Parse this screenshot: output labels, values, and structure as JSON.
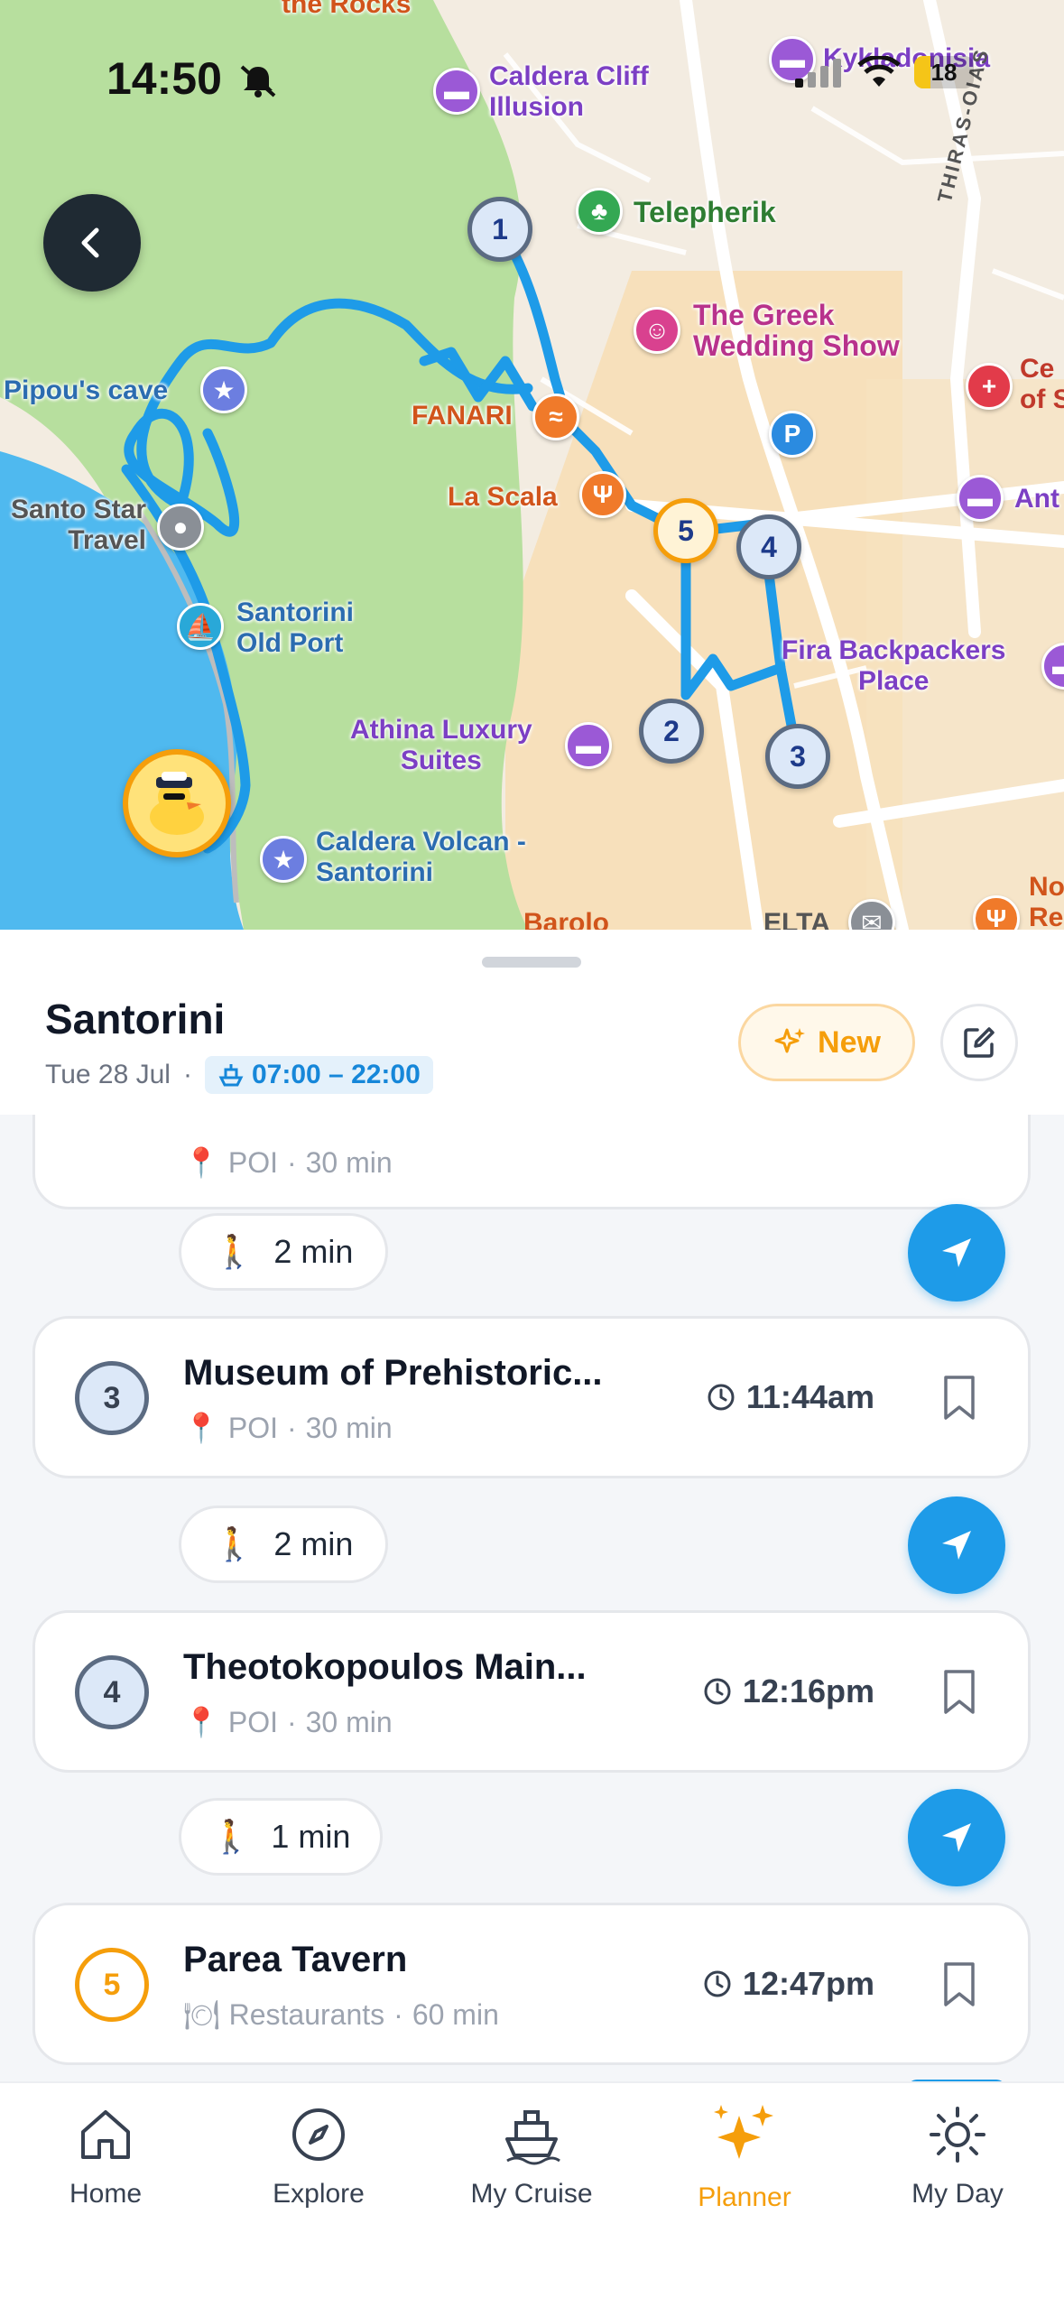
{
  "status_bar": {
    "time": "14:50",
    "battery": "18"
  },
  "map": {
    "labels": {
      "the_rocks": "the Rocks",
      "caldera_cliff": "Caldera Cliff\nIllusion",
      "kykladonisia": "Kykladonisia",
      "telepherik": "Telepherik",
      "thiras_oias": "THIRAS-OIAS",
      "greek_wedding": "The Greek\nWedding Show",
      "pipous_cave": "Pipou's cave",
      "fanari": "FANARI",
      "la_scala": "La Scala",
      "santo_star": "Santo Star\nTravel",
      "old_port": "Santorini\nOld Port",
      "fira_backpackers": "Fira Backpackers\nPlace",
      "athina": "Athina Luxury\nSuites",
      "caldera_volcan": "Caldera Volcan -\nSantorini",
      "barolo": "Barolo",
      "elta": "ELTA",
      "ce_of_s": "Ce\nof S",
      "ant": "Ant",
      "no_re": "No\nRe"
    },
    "stops": [
      "1",
      "2",
      "3",
      "4",
      "5"
    ]
  },
  "header": {
    "title": "Santorini",
    "date": "Tue 28 Jul",
    "separator": "·",
    "hours": "07:00 – 22:00",
    "new_label": "New"
  },
  "itinerary": {
    "partial_card": {
      "category": "POI",
      "duration": "30 min",
      "dot": "·"
    },
    "walks": [
      "2 min",
      "2 min",
      "1 min"
    ],
    "items": [
      {
        "number": "3",
        "name": "Museum of Prehistoric...",
        "category": "POI",
        "duration": "30 min",
        "dot": "·",
        "time": "11:44am"
      },
      {
        "number": "4",
        "name": "Theotokopoulos Main...",
        "category": "POI",
        "duration": "30 min",
        "dot": "·",
        "time": "12:16pm"
      },
      {
        "number": "5",
        "name": "Parea Tavern",
        "category": "Restaurants",
        "duration": "60 min",
        "dot": "·",
        "time": "12:47pm"
      }
    ]
  },
  "tabs": [
    {
      "label": "Home",
      "icon": "house-icon"
    },
    {
      "label": "Explore",
      "icon": "compass-icon"
    },
    {
      "label": "My Cruise",
      "icon": "ship-icon"
    },
    {
      "label": "Planner",
      "icon": "sparkles-icon",
      "active": true
    },
    {
      "label": "My Day",
      "icon": "sun-icon"
    }
  ],
  "colors": {
    "accent": "#f59e0b",
    "primary_blue": "#1e9be8",
    "route": "#1e9be8",
    "sea": "#4fb9ef",
    "park": "#b7df9e"
  }
}
